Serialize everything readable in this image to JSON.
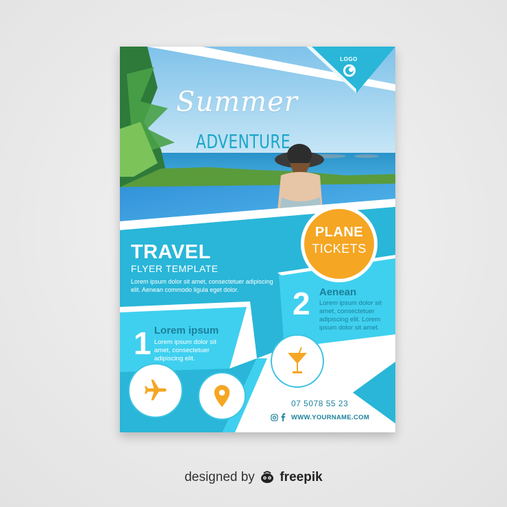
{
  "flyer": {
    "logo": "LOGO",
    "title_script": "Summer",
    "title": "ADVENTURE",
    "badge": {
      "line1": "PLANE",
      "line2": "TICKETS"
    },
    "heading": "TRAVEL",
    "subheading": "FLYER TEMPLATE",
    "intro": "Lorem ipsum dolor sit amet, consectetuer adipiscing elit. Aenean commodo ligula eget dolor.",
    "item1": {
      "number": "1",
      "title": "Lorem ipsum",
      "text": "Lorem ipsum dolor sit amet, consectetuer adipiscing elit."
    },
    "item2": {
      "number": "2",
      "title": "Aenean",
      "text": "Lorem ipsum dolor sit amet, consectetuer adipiscing elit. Lorem ipsum dolor sit amet."
    },
    "icons": [
      "plane-icon",
      "location-pin-icon",
      "cocktail-glass-icon",
      "instagram-icon",
      "facebook-icon"
    ],
    "phone": "07 5078 55 23",
    "website": "WWW.YOURNAME.COM",
    "colors": {
      "primary": "#29b6d8",
      "light": "#3fd0ef",
      "accent": "#f5a623",
      "dark_text": "#1b7f9a"
    }
  },
  "credit": {
    "prefix": "designed by",
    "brand": "freepik"
  }
}
